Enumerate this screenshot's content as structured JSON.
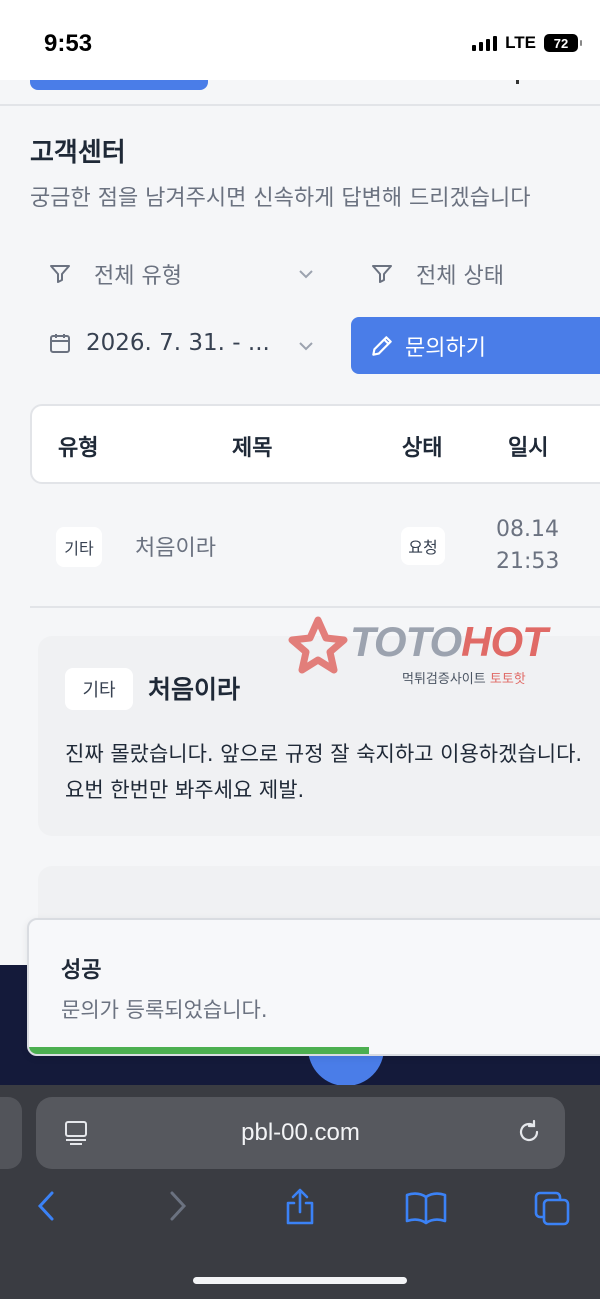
{
  "status_bar": {
    "time": "9:53",
    "network": "LTE",
    "battery": "72"
  },
  "page": {
    "title": "고객센터",
    "subtitle": "궁금한 점을 남겨주시면 신속하게 답변해 드리겠습니다",
    "filters": {
      "type": "전체 유형",
      "status": "전체 상태",
      "date": "2026. 7. 31. - ..."
    },
    "ask_button": "문의하기",
    "table": {
      "headers": [
        "유형",
        "제목",
        "상태",
        "일시"
      ],
      "rows": [
        {
          "type": "기타",
          "title": "처음이라",
          "status": "요청",
          "date": "08.14",
          "time": "21:53"
        }
      ]
    },
    "detail": {
      "tag": "기타",
      "title": "처음이라",
      "body": "진짜 몰랐습니다. 앞으로 규정 잘 숙지하고 이용하겠습니다. 요번 한번만 봐주세요 제발."
    },
    "watermark": {
      "brand_gray": "TOTO",
      "brand_red": "HOT",
      "sub_gray": "먹튀검증사이트",
      "sub_red": "토토핫"
    }
  },
  "toast": {
    "title": "성공",
    "message": "문의가 등록되었습니다.",
    "progress": 0.57
  },
  "browser": {
    "url": "pbl-00.com"
  },
  "colors": {
    "accent": "#4a7de8",
    "success": "#4caf50",
    "brand_red": "#e06a66",
    "footer_dark": "#141a3a"
  }
}
